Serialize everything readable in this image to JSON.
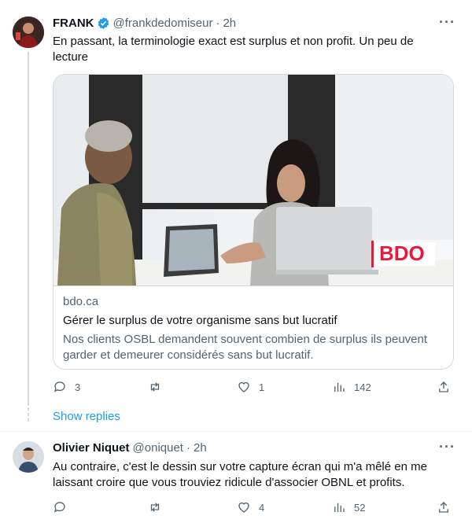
{
  "tweet1": {
    "name": "FRANK",
    "handle": "@frankdedomiseur",
    "separator": "·",
    "time": "2h",
    "more": "···",
    "text": "En passant, la terminologie exact est surplus et non profit. Un peu de lecture",
    "card": {
      "domain": "bdo.ca",
      "title": "Gérer le surplus de votre organisme sans but lucratif",
      "description": "Nos clients OSBL demandent souvent combien de surplus ils peuvent garder et demeurer considérés sans but lucratif.",
      "logo_text": "BDO",
      "logo_color": "#e81a3b"
    },
    "actions": {
      "replies": "3",
      "reposts": "",
      "likes": "1",
      "views": "142"
    }
  },
  "show_replies": "Show replies",
  "tweet2": {
    "name": "Olivier Niquet",
    "handle": "@oniquet",
    "separator": "·",
    "time": "2h",
    "more": "···",
    "text": "Au contraire, c'est le dessin sur votre capture écran qui m'a mêlé en me laissant croire que vous trouviez ridicule d'associer OBNL et profits.",
    "actions": {
      "replies": "",
      "reposts": "",
      "likes": "4",
      "views": "52"
    }
  },
  "colors": {
    "accent": "#1d9bf0",
    "verified": "#1d9bf0",
    "muted": "#536471"
  }
}
